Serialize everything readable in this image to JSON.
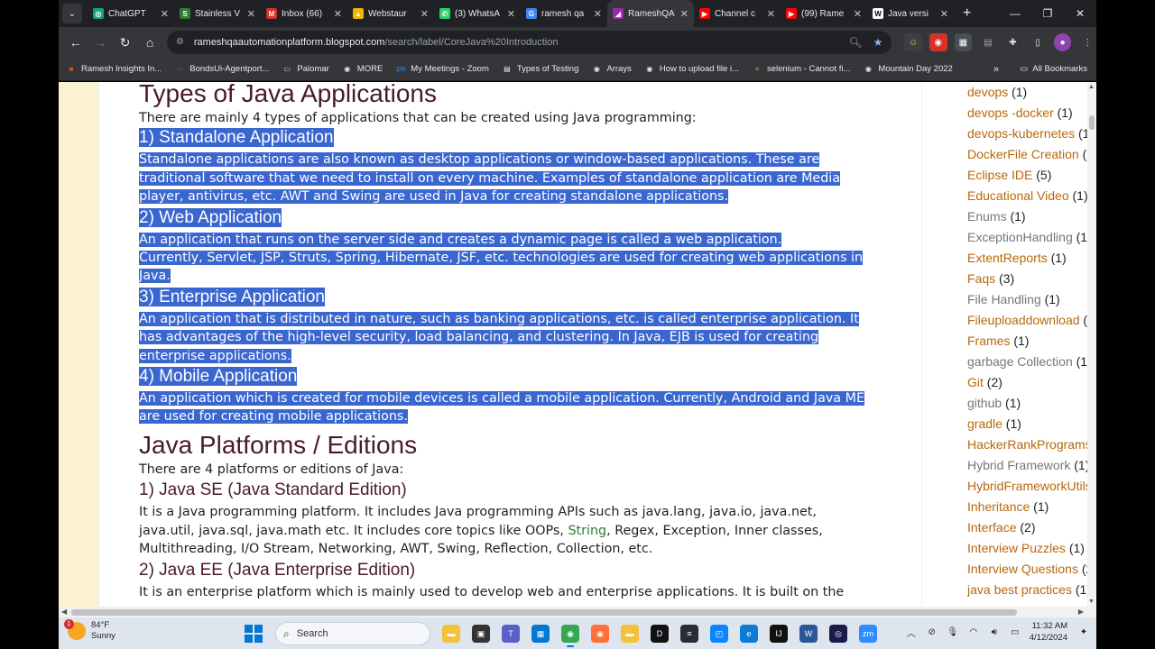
{
  "browser": {
    "tabs": [
      {
        "label": "ChatGPT",
        "favicon": "chatgpt-icon",
        "color": "#10a37f",
        "glyph": "◎"
      },
      {
        "label": "Stainless V",
        "favicon": "stainless-icon",
        "color": "#2e7d32",
        "glyph": "S"
      },
      {
        "label": "Inbox (66)",
        "favicon": "gmail-icon",
        "color": "#d93025",
        "glyph": "M"
      },
      {
        "label": "Webstaur",
        "favicon": "drive-icon",
        "color": "#f4b400",
        "glyph": "▲"
      },
      {
        "label": "(3) WhatsA",
        "favicon": "whatsapp-icon",
        "color": "#25d366",
        "glyph": "✆"
      },
      {
        "label": "ramesh qa",
        "favicon": "google-icon",
        "color": "#4285f4",
        "glyph": "G"
      },
      {
        "label": "RameshQA",
        "favicon": "blogger-icon",
        "color": "#9c27b0",
        "glyph": "◢",
        "active": true
      },
      {
        "label": "Channel c",
        "favicon": "youtube-icon",
        "color": "#ff0000",
        "glyph": "▶"
      },
      {
        "label": "(99) Rame",
        "favicon": "youtube-icon",
        "color": "#ff0000",
        "glyph": "▶"
      },
      {
        "label": "Java versi",
        "favicon": "wikipedia-icon",
        "color": "#ffffff",
        "glyph": "W"
      }
    ],
    "url_host": "rameshqaautomationplatform.blogspot.com",
    "url_path": "/search/label/CoreJava%20Introduction"
  },
  "bookmarks": [
    {
      "label": "Ramesh Insights In...",
      "icon": "linkedin-icon",
      "color": "#c75b12",
      "glyph": "■"
    },
    {
      "label": "BondsUi-Agentport...",
      "icon": "page-icon",
      "color": "#5f6368",
      "glyph": "▭"
    },
    {
      "label": "Palomar",
      "icon": "folder-icon",
      "color": "#e8eaed",
      "glyph": "▭"
    },
    {
      "label": "MORE",
      "icon": "globe-icon",
      "color": "#e8eaed",
      "glyph": "◉"
    },
    {
      "label": "My Meetings - Zoom",
      "icon": "zoom-icon",
      "color": "#2d8cff",
      "glyph": "zm"
    },
    {
      "label": "Types of Testing",
      "icon": "doc-icon",
      "color": "#e8eaed",
      "glyph": "▤"
    },
    {
      "label": "Arrays",
      "icon": "globe-icon",
      "color": "#e8eaed",
      "glyph": "◉"
    },
    {
      "label": "How to upload file i...",
      "icon": "globe-icon",
      "color": "#e8eaed",
      "glyph": "◉"
    },
    {
      "label": "selenium - Cannot fi...",
      "icon": "stackoverflow-icon",
      "color": "#f48024",
      "glyph": "≡"
    },
    {
      "label": "Mountain Day 2022",
      "icon": "globe-icon",
      "color": "#e8eaed",
      "glyph": "◉"
    }
  ],
  "bookmarks_all": "All Bookmarks",
  "article": {
    "h1": "Types of Java Applications",
    "intro": "There are mainly 4 types of applications that can be created using Java programming:",
    "s1_title": "1) Standalone Application",
    "s1_l1": "Standalone applications are also known as desktop applications or window-based applications. These are",
    "s1_l2": "traditional software that we need to install on every machine. Examples of standalone application are Media",
    "s1_l3": "player, antivirus, etc. AWT and Swing are used in Java for creating standalone applications.",
    "s2_title": "2) Web Application",
    "s2_l1": "An application that runs on the server side and creates a dynamic page is called a web application.",
    "s2_l2": "Currently, Servlet, JSP, Struts, Spring, Hibernate, JSF, etc. technologies are used for creating web applications in",
    "s2_l3": "Java.",
    "s3_title": "3) Enterprise Application",
    "s3_l1": "An application that is distributed in nature, such as banking applications, etc. is called enterprise application. It",
    "s3_l2": "has advantages of the high-level security, load balancing, and clustering. In Java, EJB is used for creating",
    "s3_l3": "enterprise applications.",
    "s4_title": "4) Mobile Application",
    "s4_l1": "An application which is created for mobile devices is called a mobile application. Currently, Android and Java ME",
    "s4_l2": "are used for creating mobile applications.",
    "h2": "Java Platforms / Editions",
    "platforms_intro": "There are 4 platforms or editions of Java:",
    "se_title": "1) Java SE (Java Standard Edition)",
    "se_l1": "It is a Java programming platform. It includes Java programming APIs such as java.lang, java.io, java.net,",
    "se_l2a": "java.util, java.sql, java.math etc. It includes core topics like OOPs, ",
    "se_l2_link": "String",
    "se_l2b": ", Regex, Exception, Inner classes,",
    "se_l3": "Multithreading, I/O Stream, Networking, AWT, Swing, Reflection, Collection, etc.",
    "ee_title": "2) Java EE (Java Enterprise Edition)",
    "ee_l1": "It is an enterprise platform which is mainly used to develop web and enterprise applications. It is built on the"
  },
  "sidebar": [
    {
      "label": "devops",
      "count": " (1)",
      "muted": false
    },
    {
      "label": "devops -docker",
      "count": " (1)",
      "muted": false
    },
    {
      "label": "devops-kubernetes",
      "count": " (1",
      "muted": false
    },
    {
      "label": "DockerFile Creation",
      "count": " (",
      "muted": false
    },
    {
      "label": "Eclipse IDE",
      "count": " (5)",
      "muted": false
    },
    {
      "label": "Educational Video",
      "count": " (1)",
      "muted": false
    },
    {
      "label": "Enums",
      "count": " (1)",
      "muted": true
    },
    {
      "label": "ExceptionHandling",
      "count": " (1)",
      "muted": true
    },
    {
      "label": "ExtentReports",
      "count": " (1)",
      "muted": false
    },
    {
      "label": "Faqs",
      "count": " (3)",
      "muted": false
    },
    {
      "label": "File Handling",
      "count": " (1)",
      "muted": true
    },
    {
      "label": "Fileuploaddownload",
      "count": " (",
      "muted": false
    },
    {
      "label": "Frames",
      "count": " (1)",
      "muted": false
    },
    {
      "label": "garbage Collection",
      "count": " (1)",
      "muted": true
    },
    {
      "label": "Git",
      "count": " (2)",
      "muted": false
    },
    {
      "label": "github",
      "count": " (1)",
      "muted": true
    },
    {
      "label": "gradle",
      "count": " (1)",
      "muted": false
    },
    {
      "label": "HackerRankPrograms",
      "count": "",
      "muted": false
    },
    {
      "label": "Hybrid Framework",
      "count": " (1)",
      "muted": true
    },
    {
      "label": "HybridFrameworkUtils",
      "count": "",
      "muted": false
    },
    {
      "label": "Inheritance",
      "count": " (1)",
      "muted": false
    },
    {
      "label": "Interface",
      "count": " (2)",
      "muted": false
    },
    {
      "label": "Interview Puzzles",
      "count": " (1)",
      "muted": false
    },
    {
      "label": "Interview Questions",
      "count": " (2",
      "muted": false
    },
    {
      "label": "java best practices",
      "count": " (1)",
      "muted": false
    }
  ],
  "taskbar": {
    "temp": "84°F",
    "condition": "Sunny",
    "weather_badge": "1",
    "search_placeholder": "Search",
    "time": "11:32 AM",
    "date": "4/12/2024",
    "apps": [
      {
        "name": "file-explorer-app-icon",
        "color": "#f3c13a",
        "glyph": "▬"
      },
      {
        "name": "task-view-icon",
        "color": "#333333",
        "glyph": "▣"
      },
      {
        "name": "teams-icon",
        "color": "#5b5fc7",
        "glyph": "T"
      },
      {
        "name": "store-icon",
        "color": "#0078d4",
        "glyph": "▦"
      },
      {
        "name": "chrome-icon",
        "color": "#34a853",
        "glyph": "◉",
        "active": true
      },
      {
        "name": "firefox-icon",
        "color": "#ff7139",
        "glyph": "◉"
      },
      {
        "name": "folder-icon",
        "color": "#f3c13a",
        "glyph": "▬"
      },
      {
        "name": "dell-icon",
        "color": "#111111",
        "glyph": "D"
      },
      {
        "name": "terminal-icon",
        "color": "#2b2b3a",
        "glyph": "≡"
      },
      {
        "name": "snip-icon",
        "color": "#0a84ff",
        "glyph": "◰"
      },
      {
        "name": "edge-icon",
        "color": "#0c7bd6",
        "glyph": "e"
      },
      {
        "name": "intellij-icon",
        "color": "#111111",
        "glyph": "IJ"
      },
      {
        "name": "word-icon",
        "color": "#2b579a",
        "glyph": "W"
      },
      {
        "name": "vpn-icon",
        "color": "#1a1a4a",
        "glyph": "◎"
      },
      {
        "name": "zoom-icon",
        "color": "#2d8cff",
        "glyph": "zm"
      }
    ]
  }
}
